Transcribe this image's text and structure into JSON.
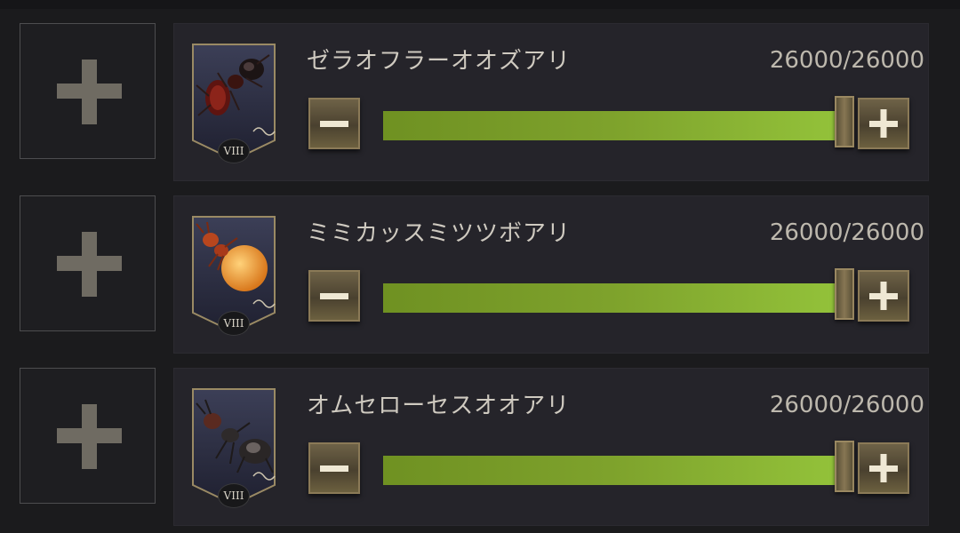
{
  "slots": [
    {
      "add_icon": "plus-icon",
      "ant": {
        "name": "ゼラオフラーオオズアリ",
        "count_text": "26000/26000",
        "current": 26000,
        "max": 26000,
        "rank": "VIII",
        "portrait_icon": "ant-portrait-red",
        "dna_icon": "dna-icon"
      }
    },
    {
      "add_icon": "plus-icon",
      "ant": {
        "name": "ミミカッスミツツボアリ",
        "count_text": "26000/26000",
        "current": 26000,
        "max": 26000,
        "rank": "VIII",
        "portrait_icon": "ant-portrait-honeypot",
        "dna_icon": "dna-icon"
      }
    },
    {
      "add_icon": "plus-icon",
      "ant": {
        "name": "オムセローセスオオアリ",
        "count_text": "26000/26000",
        "current": 26000,
        "max": 26000,
        "rank": "VIII",
        "portrait_icon": "ant-portrait-carpenter",
        "dna_icon": "dna-icon"
      }
    }
  ],
  "controls": {
    "decrease_icon": "minus-icon",
    "increase_icon": "plus-icon"
  },
  "colors": {
    "bar_fill": "#8ab535",
    "button_gold": "#8b7a57",
    "panel_bg": "#25242a"
  }
}
